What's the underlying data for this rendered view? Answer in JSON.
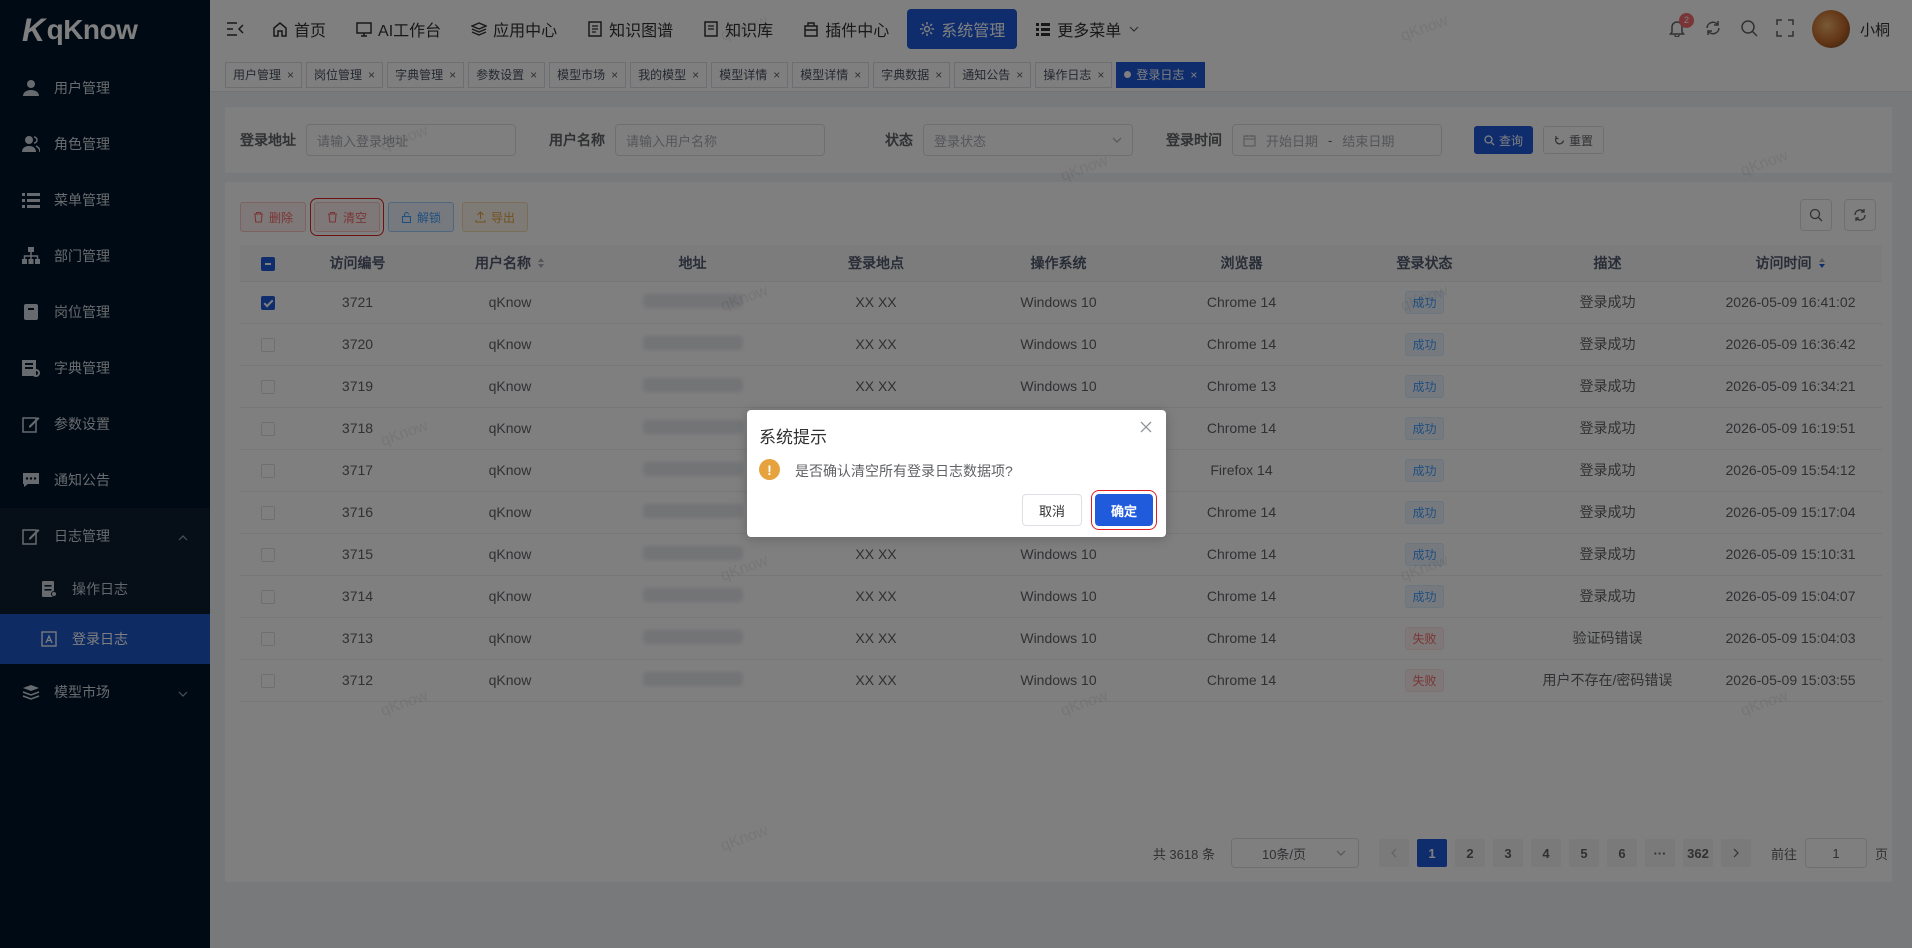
{
  "app": {
    "logo_text": "qKnow"
  },
  "sidebar": {
    "items": [
      {
        "label": "用户管理",
        "icon": "user-icon"
      },
      {
        "label": "角色管理",
        "icon": "users-icon"
      },
      {
        "label": "菜单管理",
        "icon": "list-icon"
      },
      {
        "label": "部门管理",
        "icon": "tree-icon"
      },
      {
        "label": "岗位管理",
        "icon": "post-icon"
      },
      {
        "label": "字典管理",
        "icon": "dict-icon"
      },
      {
        "label": "参数设置",
        "icon": "edit-icon"
      },
      {
        "label": "通知公告",
        "icon": "message-icon"
      },
      {
        "label": "日志管理",
        "icon": "log-icon"
      }
    ],
    "subitems": [
      {
        "label": "操作日志"
      },
      {
        "label": "登录日志"
      }
    ],
    "last_item": {
      "label": "模型市场"
    }
  },
  "header": {
    "nav": [
      {
        "label": "首页"
      },
      {
        "label": "AI工作台"
      },
      {
        "label": "应用中心"
      },
      {
        "label": "知识图谱"
      },
      {
        "label": "知识库"
      },
      {
        "label": "插件中心"
      },
      {
        "label": "系统管理"
      },
      {
        "label": "更多菜单"
      }
    ],
    "notification_count": "2",
    "username": "小桐"
  },
  "tags": [
    "用户管理",
    "岗位管理",
    "字典管理",
    "参数设置",
    "模型市场",
    "我的模型",
    "模型详情",
    "模型详情",
    "字典数据",
    "通知公告",
    "操作日志",
    "登录日志"
  ],
  "search": {
    "address_label": "登录地址",
    "address_placeholder": "请输入登录地址",
    "username_label": "用户名称",
    "username_placeholder": "请输入用户名称",
    "status_label": "状态",
    "status_placeholder": "登录状态",
    "time_label": "登录时间",
    "start_placeholder": "开始日期",
    "separator": "-",
    "end_placeholder": "结束日期",
    "query_label": "查询",
    "reset_label": "重置"
  },
  "toolbar": {
    "delete_label": "删除",
    "clear_label": "清空",
    "unlock_label": "解锁",
    "export_label": "导出"
  },
  "table": {
    "headers": [
      "访问编号",
      "用户名称",
      "地址",
      "登录地点",
      "操作系统",
      "浏览器",
      "登录状态",
      "描述",
      "访问时间"
    ],
    "rows": [
      {
        "id": "3721",
        "user": "qKnow",
        "place": "XX XX",
        "os": "Windows 10",
        "browser": "Chrome 14",
        "status": "成功",
        "ok": true,
        "desc": "登录成功",
        "time": "2026-05-09 16:41:02",
        "checked": true
      },
      {
        "id": "3720",
        "user": "qKnow",
        "place": "XX XX",
        "os": "Windows 10",
        "browser": "Chrome 14",
        "status": "成功",
        "ok": true,
        "desc": "登录成功",
        "time": "2026-05-09 16:36:42",
        "checked": false
      },
      {
        "id": "3719",
        "user": "qKnow",
        "place": "XX XX",
        "os": "Windows 10",
        "browser": "Chrome 13",
        "status": "成功",
        "ok": true,
        "desc": "登录成功",
        "time": "2026-05-09 16:34:21",
        "checked": false
      },
      {
        "id": "3718",
        "user": "qKnow",
        "place": "",
        "os": "",
        "browser": "Chrome 14",
        "status": "成功",
        "ok": true,
        "desc": "登录成功",
        "time": "2026-05-09 16:19:51",
        "checked": false
      },
      {
        "id": "3717",
        "user": "qKnow",
        "place": "",
        "os": "",
        "browser": "Firefox 14",
        "status": "成功",
        "ok": true,
        "desc": "登录成功",
        "time": "2026-05-09 15:54:12",
        "checked": false
      },
      {
        "id": "3716",
        "user": "qKnow",
        "place": "",
        "os": "",
        "browser": "Chrome 14",
        "status": "成功",
        "ok": true,
        "desc": "登录成功",
        "time": "2026-05-09 15:17:04",
        "checked": false
      },
      {
        "id": "3715",
        "user": "qKnow",
        "place": "XX XX",
        "os": "Windows 10",
        "browser": "Chrome 14",
        "status": "成功",
        "ok": true,
        "desc": "登录成功",
        "time": "2026-05-09 15:10:31",
        "checked": false
      },
      {
        "id": "3714",
        "user": "qKnow",
        "place": "XX XX",
        "os": "Windows 10",
        "browser": "Chrome 14",
        "status": "成功",
        "ok": true,
        "desc": "登录成功",
        "time": "2026-05-09 15:04:07",
        "checked": false
      },
      {
        "id": "3713",
        "user": "qKnow",
        "place": "XX XX",
        "os": "Windows 10",
        "browser": "Chrome 14",
        "status": "失败",
        "ok": false,
        "desc": "验证码错误",
        "time": "2026-05-09 15:04:03",
        "checked": false
      },
      {
        "id": "3712",
        "user": "qKnow",
        "place": "XX XX",
        "os": "Windows 10",
        "browser": "Chrome 14",
        "status": "失败",
        "ok": false,
        "desc": "用户不存在/密码错误",
        "time": "2026-05-09 15:03:55",
        "checked": false
      }
    ]
  },
  "pagination": {
    "total_text": "共 3618 条",
    "page_size": "10条/页",
    "pages": [
      "1",
      "2",
      "3",
      "4",
      "5",
      "6",
      "···",
      "362"
    ],
    "goto_label": "前往",
    "goto_value": "1",
    "page_suffix": "页"
  },
  "watermark": "qKnow",
  "dialog": {
    "title": "系统提示",
    "message": "是否确认清空所有登录日志数据项?",
    "icon": "!",
    "cancel_label": "取消",
    "confirm_label": "确定"
  },
  "colors": {
    "primary": "#1f5bdb",
    "sidebar_bg": "#001529",
    "warning": "#e6a23c",
    "danger": "#f56c6c"
  }
}
